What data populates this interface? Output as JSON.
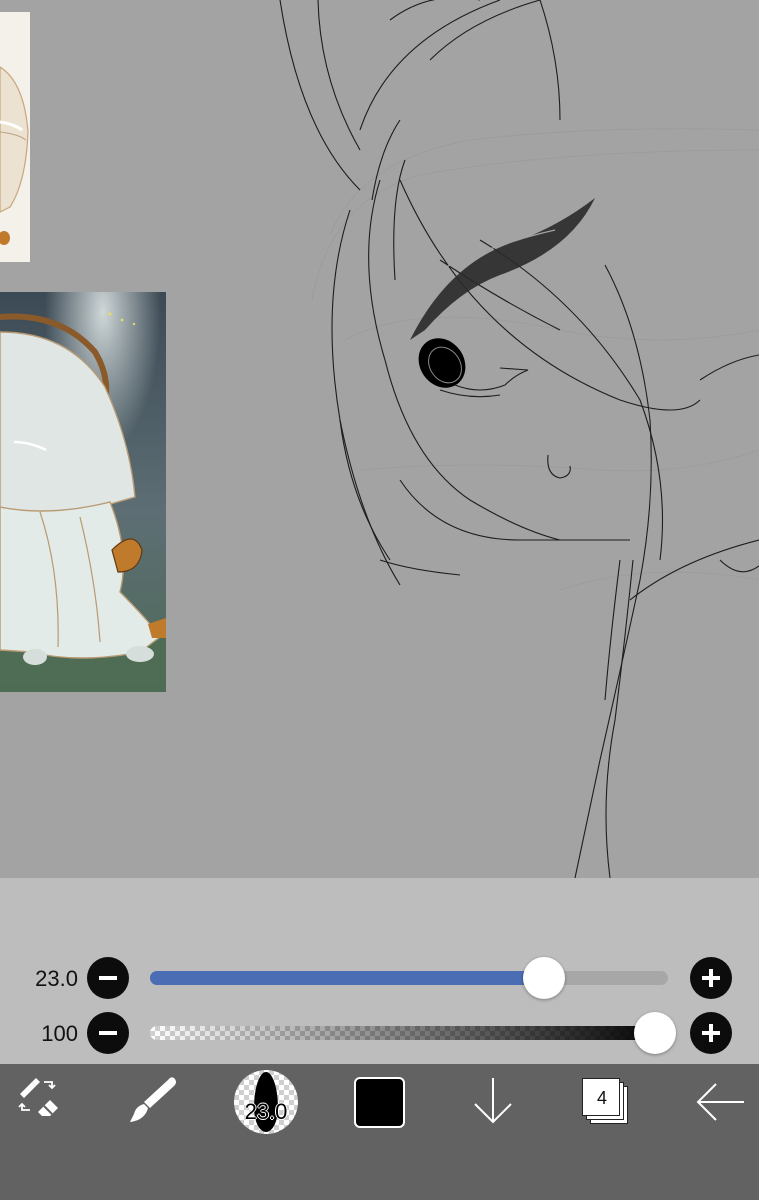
{
  "colors": {
    "canvas_background": "#a3a3a3",
    "slider_panel": "#bdbdbd",
    "toolbar": "#626262",
    "size_fill": "#4a6db3",
    "current_color": "#000000"
  },
  "sliders": {
    "size": {
      "value_label": "23.0",
      "level_fraction": 0.76
    },
    "opacity": {
      "value_label": "100",
      "level_fraction": 1.0
    }
  },
  "toolbar": {
    "transform_icon": "transform-eraser-icon",
    "brush_icon": "brush-icon",
    "brush_size_label": "23.0",
    "color_swatch": "current-color",
    "download_icon": "arrow-down-icon",
    "layer_count": "4",
    "back_icon": "arrow-left-icon"
  }
}
